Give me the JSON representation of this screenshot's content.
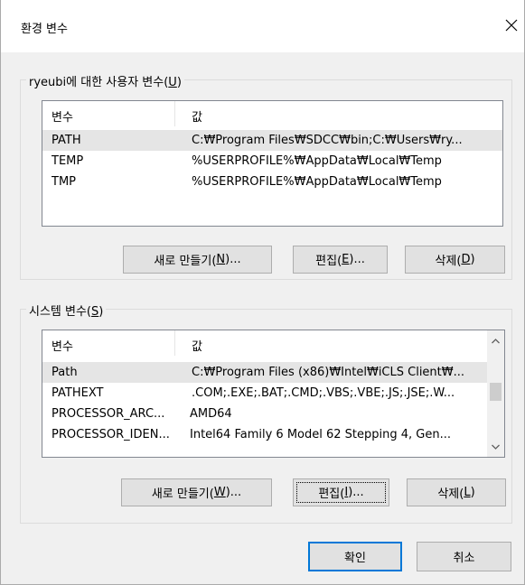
{
  "window": {
    "title": "환경 변수"
  },
  "user_vars": {
    "legend_prefix": "ryeubi에 대한 사용자 변수(",
    "legend_key": "U",
    "legend_suffix": ")",
    "columns": [
      "변수",
      "값"
    ],
    "rows": [
      {
        "name": "PATH",
        "value": "C:₩Program Files₩SDCC₩bin;C:₩Users₩ry...",
        "selected": true
      },
      {
        "name": "TEMP",
        "value": "%USERPROFILE%₩AppData₩Local₩Temp",
        "selected": false
      },
      {
        "name": "TMP",
        "value": "%USERPROFILE%₩AppData₩Local₩Temp",
        "selected": false
      }
    ],
    "buttons": {
      "new": {
        "text": "새로 만들기(",
        "key": "N",
        "tail": ")..."
      },
      "edit": {
        "text": "편집(",
        "key": "E",
        "tail": ")..."
      },
      "delete": {
        "text": "삭제(",
        "key": "D",
        "tail": ")"
      }
    }
  },
  "system_vars": {
    "legend_prefix": "시스템 변수(",
    "legend_key": "S",
    "legend_suffix": ")",
    "columns": [
      "변수",
      "값"
    ],
    "rows": [
      {
        "name": "Path",
        "value": "C:₩Program Files (x86)₩Intel₩iCLS Client₩...",
        "selected": true
      },
      {
        "name": "PATHEXT",
        "value": ".COM;.EXE;.BAT;.CMD;.VBS;.VBE;.JS;.JSE;.W...",
        "selected": false
      },
      {
        "name": "PROCESSOR_ARC...",
        "value": "AMD64",
        "selected": false
      },
      {
        "name": "PROCESSOR_IDEN...",
        "value": "Intel64 Family 6 Model 62 Stepping 4, Gen...",
        "selected": false
      }
    ],
    "buttons": {
      "new": {
        "text": "새로 만들기(",
        "key": "W",
        "tail": ")..."
      },
      "edit": {
        "text": "편집(",
        "key": "I",
        "tail": ")..."
      },
      "delete": {
        "text": "삭제(",
        "key": "L",
        "tail": ")"
      }
    }
  },
  "dialog_buttons": {
    "ok": "확인",
    "cancel": "취소"
  },
  "icons": {
    "close": "close-icon",
    "scroll_up": "chevron-up-icon",
    "scroll_down": "chevron-down-icon"
  },
  "colors": {
    "accent": "#0078d7",
    "selection": "#e5e5e5",
    "button_face": "#e1e1e1",
    "dialog_bg": "#f0f0f0"
  }
}
